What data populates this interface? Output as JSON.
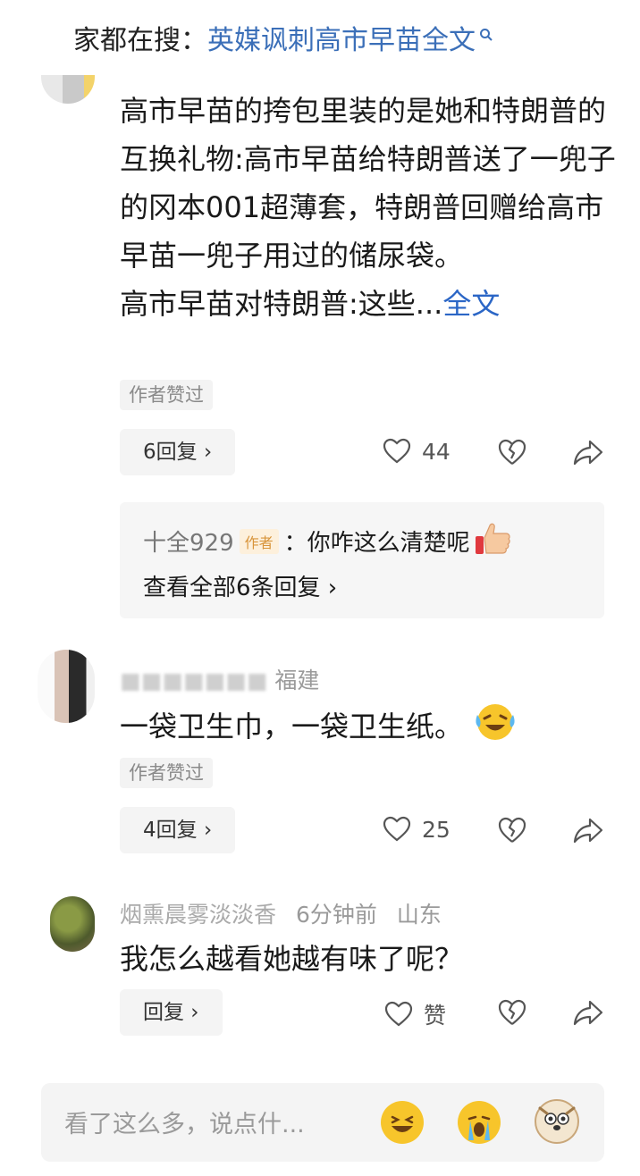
{
  "search": {
    "prefix": "家都在搜：",
    "keyword": "英媒讽刺高市早苗全文"
  },
  "comments": [
    {
      "text": "高市早苗的挎包里装的是她和特朗普的互换礼物:高市早苗给特朗普送了一兜子的冈本001超薄套，特朗普回赠给高市早苗一兜子用过的储尿袋。",
      "text_line2": "高市早苗对特朗普:这些...",
      "more_label": "全文",
      "author_liked": "作者赞过",
      "reply_label": "6回复 ›",
      "likes": "44",
      "sub_reply": {
        "username": "十全929",
        "author_tag": "作者",
        "text": "：你咋这么清楚呢",
        "view_all": "查看全部6条回复 ›"
      }
    },
    {
      "meta": "福建",
      "text": "一袋卫生巾，一袋卫生纸。",
      "author_liked": "作者赞过",
      "reply_label": "4回复 ›",
      "likes": "25"
    },
    {
      "meta_name": "烟熏晨雾淡淡香",
      "meta_time": "6分钟前",
      "meta_location": "山东",
      "text": "我怎么越看她越有味了呢？",
      "reply_label": "回复 ›",
      "likes": "赞"
    }
  ],
  "input": {
    "placeholder": "看了这么多，说点什..."
  },
  "colors": {
    "link": "#2b66c6",
    "search_keyword": "#3b6fb8",
    "tag_bg": "#fdf0dc",
    "tag_text": "#d8943a"
  }
}
